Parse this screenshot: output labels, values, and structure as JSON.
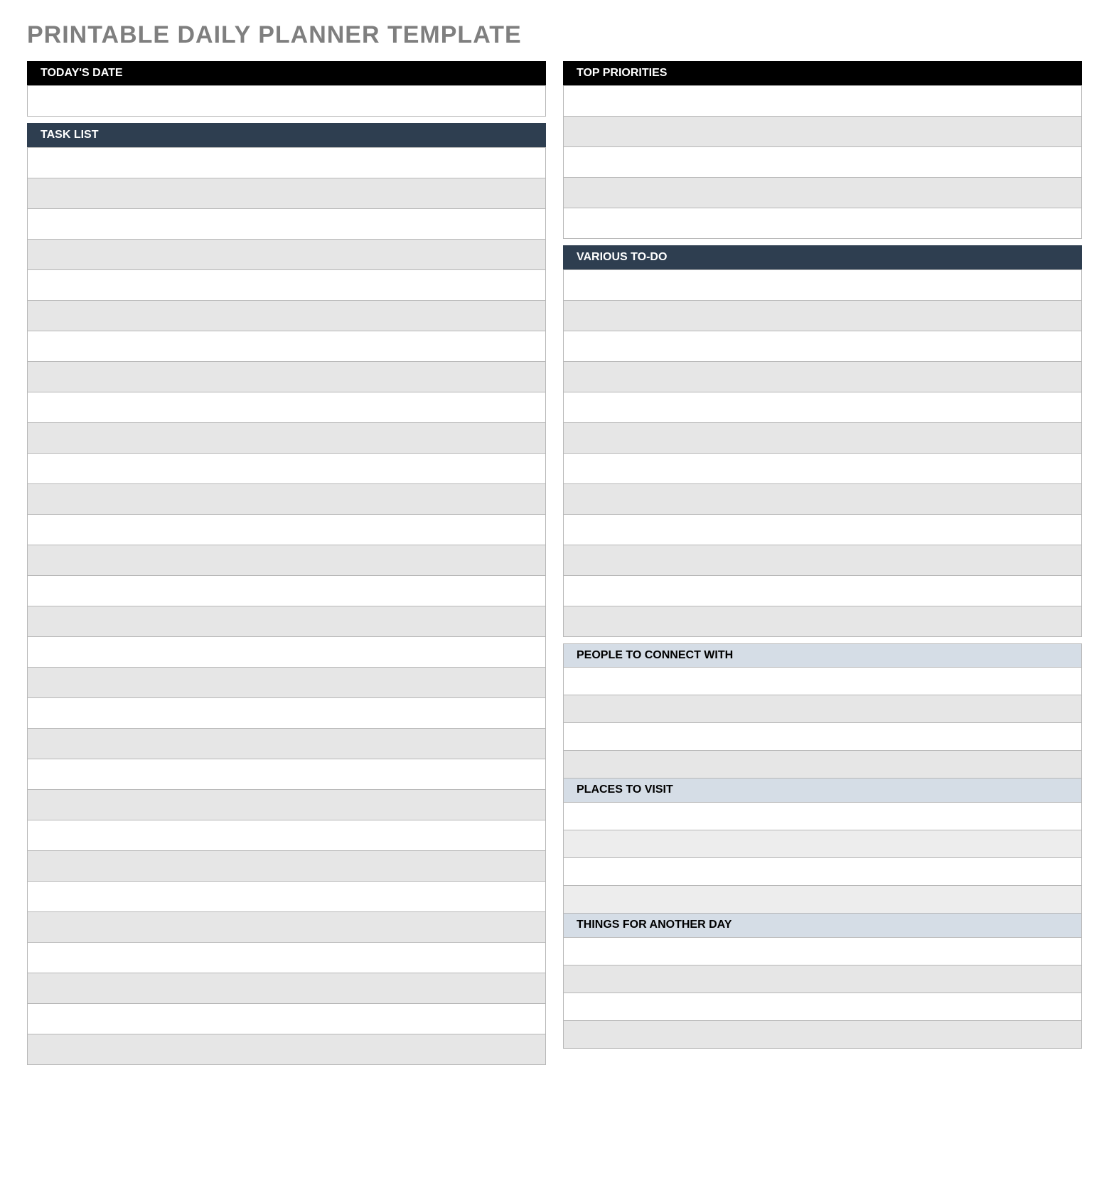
{
  "title": "PRINTABLE DAILY PLANNER TEMPLATE",
  "left": {
    "todays_date": {
      "label": "TODAY'S DATE",
      "rows": [
        ""
      ]
    },
    "task_list": {
      "label": "TASK LIST",
      "rows": [
        "",
        "",
        "",
        "",
        "",
        "",
        "",
        "",
        "",
        "",
        "",
        "",
        "",
        "",
        "",
        "",
        "",
        "",
        "",
        "",
        "",
        "",
        "",
        "",
        "",
        "",
        "",
        "",
        "",
        "",
        ""
      ]
    }
  },
  "right": {
    "top_priorities": {
      "label": "TOP PRIORITIES",
      "rows": [
        "",
        "",
        "",
        "",
        ""
      ]
    },
    "various_todo": {
      "label": "VARIOUS TO-DO",
      "rows": [
        "",
        "",
        "",
        "",
        "",
        "",
        "",
        "",
        "",
        "",
        "",
        "",
        ""
      ]
    },
    "people_to_connect": {
      "label": "PEOPLE TO CONNECT WITH",
      "rows": [
        "",
        "",
        "",
        ""
      ]
    },
    "places_to_visit": {
      "label": "PLACES TO VISIT",
      "rows": [
        "",
        "",
        "",
        ""
      ]
    },
    "things_another_day": {
      "label": "THINGS FOR ANOTHER DAY",
      "rows": [
        "",
        "",
        "",
        ""
      ]
    }
  }
}
